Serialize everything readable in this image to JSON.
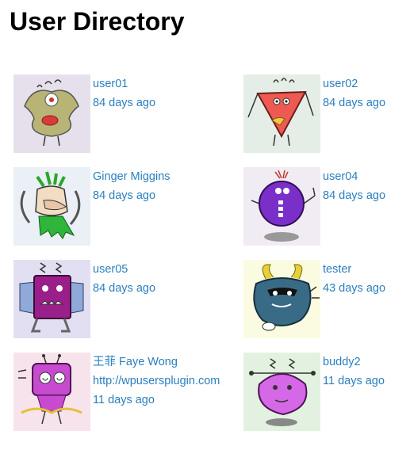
{
  "page": {
    "title": "User Directory"
  },
  "colors": {
    "link": "#2a7fbf"
  },
  "users": [
    {
      "name": "user01",
      "last_seen": "84 days ago",
      "avatar_icon": "monster-avatar-olive-icon"
    },
    {
      "name": "user02",
      "last_seen": "84 days ago",
      "avatar_icon": "monster-avatar-red-triangle-icon"
    },
    {
      "name": "Ginger Miggins",
      "last_seen": "84 days ago",
      "avatar_icon": "monster-avatar-green-icon"
    },
    {
      "name": "user04",
      "last_seen": "84 days ago",
      "avatar_icon": "monster-avatar-purple-round-icon"
    },
    {
      "name": "user05",
      "last_seen": "84 days ago",
      "avatar_icon": "monster-avatar-magenta-box-icon"
    },
    {
      "name": "tester",
      "last_seen": "43 days ago",
      "avatar_icon": "monster-avatar-blue-horned-icon"
    },
    {
      "name": "王菲 Faye Wong",
      "website": "http://wpusersplugin.com",
      "last_seen": "11 days ago",
      "avatar_icon": "monster-avatar-pink-bug-icon"
    },
    {
      "name": "buddy2",
      "last_seen": "11 days ago",
      "avatar_icon": "monster-avatar-pink-blob-icon"
    }
  ]
}
